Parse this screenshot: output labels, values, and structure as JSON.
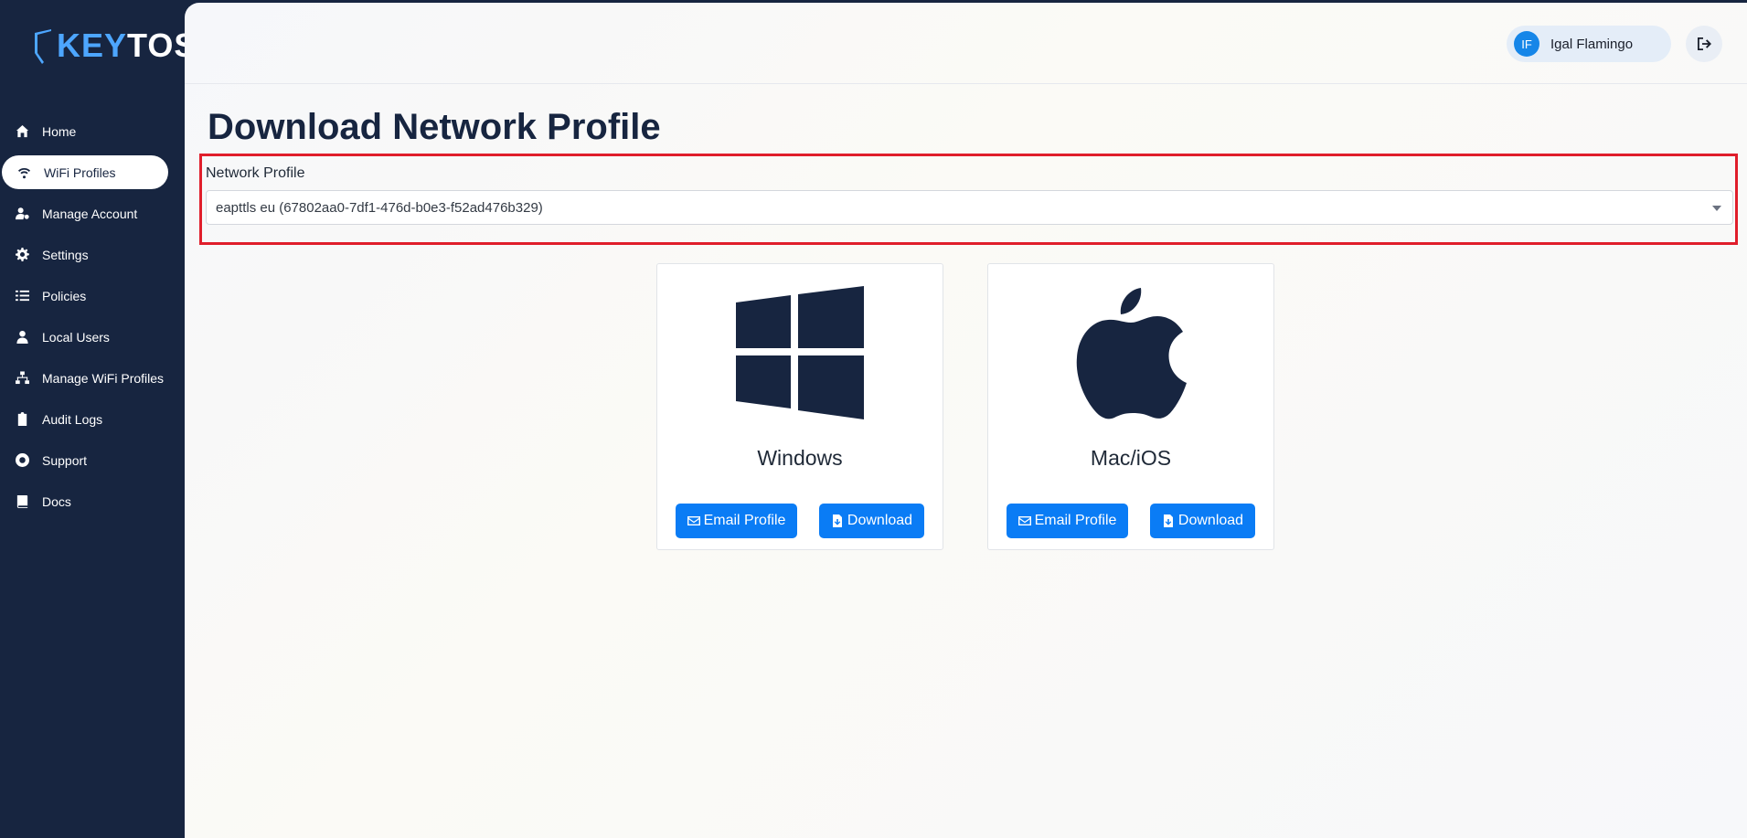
{
  "brand": {
    "logo_text_a": "KEY",
    "logo_text_b": "TOS"
  },
  "sidebar": {
    "items": [
      {
        "label": "Home",
        "icon": "home-icon"
      },
      {
        "label": "WiFi Profiles",
        "icon": "wifi-icon",
        "active": true
      },
      {
        "label": "Manage Account",
        "icon": "user-gear-icon"
      },
      {
        "label": "Settings",
        "icon": "gear-icon"
      },
      {
        "label": "Policies",
        "icon": "list-check-icon"
      },
      {
        "label": "Local Users",
        "icon": "user-icon"
      },
      {
        "label": "Manage WiFi Profiles",
        "icon": "network-icon"
      },
      {
        "label": "Audit Logs",
        "icon": "clipboard-icon"
      },
      {
        "label": "Support",
        "icon": "lifebuoy-icon"
      },
      {
        "label": "Docs",
        "icon": "book-icon"
      }
    ]
  },
  "header": {
    "user_initials": "IF",
    "user_name": "Igal Flamingo",
    "logout_icon": "logout-icon"
  },
  "main": {
    "title": "Download Network Profile",
    "profile_label": "Network Profile",
    "profile_selected": "eapttls eu (67802aa0-7df1-476d-b0e3-f52ad476b329)",
    "cards": [
      {
        "os": "Windows",
        "icon": "windows-icon",
        "email_label": "Email Profile",
        "download_label": "Download"
      },
      {
        "os": "Mac/iOS",
        "icon": "apple-icon",
        "email_label": "Email Profile",
        "download_label": "Download"
      }
    ]
  },
  "colors": {
    "sidebar_bg": "#172540",
    "accent_blue": "#0a7cf5",
    "highlight_red": "#e01e2b",
    "avatar_blue": "#1686e8"
  }
}
